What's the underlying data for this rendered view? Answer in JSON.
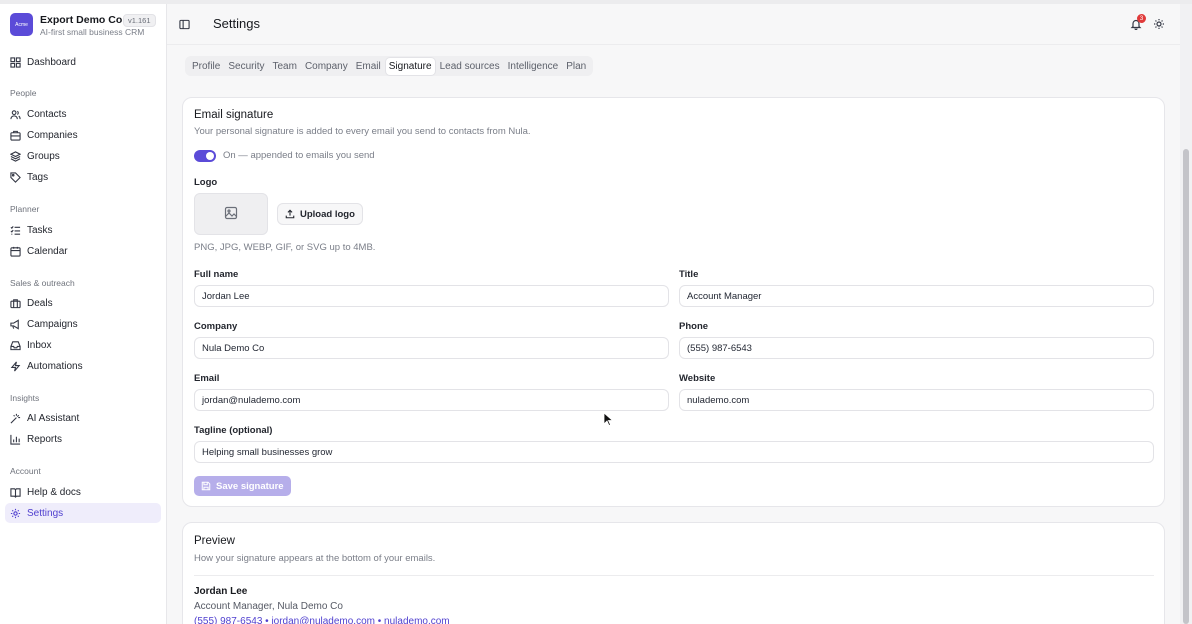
{
  "brand": {
    "logo_text": "Acme",
    "name": "Export Demo Co",
    "subtitle": "AI-first small business CRM",
    "version": "v1.161"
  },
  "sidebar": {
    "dashboard": "Dashboard",
    "sections": {
      "people": "People",
      "planner": "Planner",
      "sales": "Sales & outreach",
      "insights": "Insights",
      "account": "Account"
    },
    "items": {
      "contacts": "Contacts",
      "companies": "Companies",
      "groups": "Groups",
      "tags": "Tags",
      "tasks": "Tasks",
      "calendar": "Calendar",
      "deals": "Deals",
      "campaigns": "Campaigns",
      "inbox": "Inbox",
      "automations": "Automations",
      "ai_assistant": "AI Assistant",
      "reports": "Reports",
      "help": "Help & docs",
      "settings": "Settings"
    },
    "active": "Settings"
  },
  "header": {
    "title": "Settings",
    "notification_count": "3"
  },
  "tabs": [
    "Profile",
    "Security",
    "Team",
    "Company",
    "Email",
    "Signature",
    "Lead sources",
    "Intelligence",
    "Plan"
  ],
  "active_tab": "Signature",
  "signature": {
    "title": "Email signature",
    "description": "Your personal signature is added to every email you send to contacts from Nula.",
    "toggle_label": "On — appended to emails you send",
    "toggle_on": true,
    "logo_label": "Logo",
    "upload_label": "Upload logo",
    "logo_hint": "PNG, JPG, WEBP, GIF, or SVG up to 4MB.",
    "fields": {
      "full_name": {
        "label": "Full name",
        "value": "Jordan Lee"
      },
      "title": {
        "label": "Title",
        "value": "Account Manager"
      },
      "company": {
        "label": "Company",
        "value": "Nula Demo Co"
      },
      "phone": {
        "label": "Phone",
        "value": "(555) 987-6543"
      },
      "email": {
        "label": "Email",
        "value": "jordan@nulademo.com"
      },
      "website": {
        "label": "Website",
        "value": "nulademo.com"
      },
      "tagline": {
        "label": "Tagline (optional)",
        "value": "Helping small businesses grow"
      }
    },
    "save_label": "Save signature"
  },
  "preview": {
    "title": "Preview",
    "description": "How your signature appears at the bottom of your emails.",
    "name": "Jordan Lee",
    "role_line": "Account Manager, Nula Demo Co",
    "contact_line": "(555) 987-6543 • jordan@nulademo.com • nulademo.com"
  },
  "colors": {
    "accent": "#5b4bd8",
    "accent_soft": "#efedfb",
    "badge": "#e03a3a"
  }
}
